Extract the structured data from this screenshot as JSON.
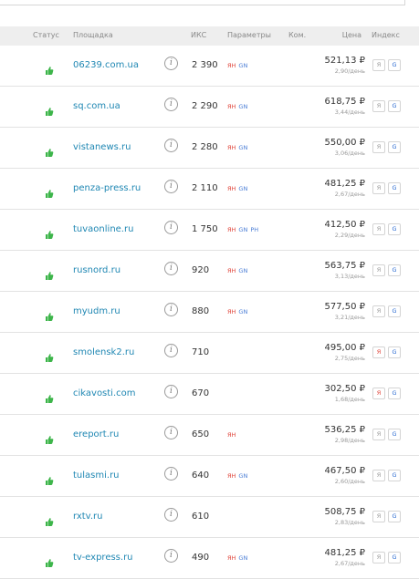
{
  "header": {
    "status": "Статус",
    "site": "Площадка",
    "iks": "ИКС",
    "params": "Параметры",
    "kom": "Ком.",
    "price": "Цена",
    "index": "Индекс"
  },
  "colors": {
    "link": "#1f87b3",
    "status_ok": "#3db54a",
    "param_yan": "#e0443a",
    "param_gn": "#4a7dd6",
    "header_bg": "#eeeeee"
  },
  "index_labels": {
    "yandex": "Я",
    "google": "G"
  },
  "rows": [
    {
      "site": "06239.com.ua",
      "iks": "2 390",
      "params": [
        "ЯН",
        "GN"
      ],
      "price": "521,13 ₽",
      "per_day": "2,90/день",
      "yandex_active": false
    },
    {
      "site": "sq.com.ua",
      "iks": "2 290",
      "params": [
        "ЯН",
        "GN"
      ],
      "price": "618,75 ₽",
      "per_day": "3,44/день",
      "yandex_active": false
    },
    {
      "site": "vistanews.ru",
      "iks": "2 280",
      "params": [
        "ЯН",
        "GN"
      ],
      "price": "550,00 ₽",
      "per_day": "3,06/день",
      "yandex_active": false
    },
    {
      "site": "penza-press.ru",
      "iks": "2 110",
      "params": [
        "ЯН",
        "GN"
      ],
      "price": "481,25 ₽",
      "per_day": "2,67/день",
      "yandex_active": false
    },
    {
      "site": "tuvaonline.ru",
      "iks": "1 750",
      "params": [
        "ЯН",
        "GN",
        "РН"
      ],
      "price": "412,50 ₽",
      "per_day": "2,29/день",
      "yandex_active": false
    },
    {
      "site": "rusnord.ru",
      "iks": "920",
      "params": [
        "ЯН",
        "GN"
      ],
      "price": "563,75 ₽",
      "per_day": "3,13/день",
      "yandex_active": false
    },
    {
      "site": "myudm.ru",
      "iks": "880",
      "params": [
        "ЯН",
        "GN"
      ],
      "price": "577,50 ₽",
      "per_day": "3,21/день",
      "yandex_active": false
    },
    {
      "site": "smolensk2.ru",
      "iks": "710",
      "params": [],
      "price": "495,00 ₽",
      "per_day": "2,75/день",
      "yandex_active": true
    },
    {
      "site": "cikavosti.com",
      "iks": "670",
      "params": [],
      "price": "302,50 ₽",
      "per_day": "1,68/день",
      "yandex_active": true
    },
    {
      "site": "ereport.ru",
      "iks": "650",
      "params": [
        "ЯН"
      ],
      "price": "536,25 ₽",
      "per_day": "2,98/день",
      "yandex_active": false
    },
    {
      "site": "tulasmi.ru",
      "iks": "640",
      "params": [
        "ЯН",
        "GN"
      ],
      "price": "467,50 ₽",
      "per_day": "2,60/день",
      "yandex_active": false
    },
    {
      "site": "rxtv.ru",
      "iks": "610",
      "params": [],
      "price": "508,75 ₽",
      "per_day": "2,83/день",
      "yandex_active": false
    },
    {
      "site": "tv-express.ru",
      "iks": "490",
      "params": [
        "ЯН",
        "GN"
      ],
      "price": "481,25 ₽",
      "per_day": "2,67/день",
      "yandex_active": false
    }
  ]
}
